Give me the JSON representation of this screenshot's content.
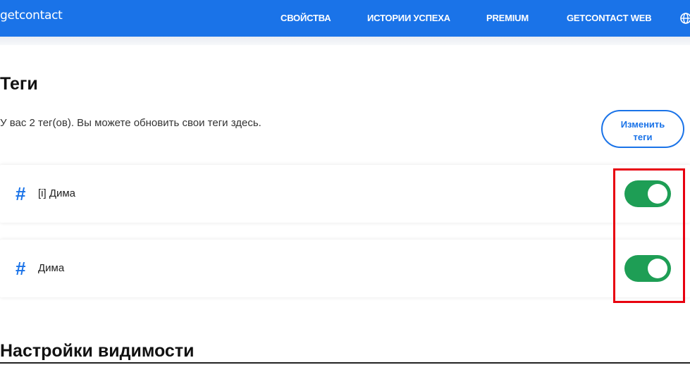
{
  "header": {
    "logo": "getcontact",
    "nav": [
      {
        "label": "СВОЙСТВА"
      },
      {
        "label": "ИСТОРИИ УСПЕХА"
      },
      {
        "label": "PREMIUM"
      },
      {
        "label": "GETCONTACT WEB"
      }
    ],
    "globe_icon": "globe-icon"
  },
  "tags": {
    "title": "Теги",
    "description": "У вас 2 тег(ов). Вы можете обновить свои теги здесь.",
    "edit_button": "Изменить теги",
    "items": [
      {
        "hash": "#",
        "label": "[i] Дима",
        "enabled": true
      },
      {
        "hash": "#",
        "label": "Дима",
        "enabled": true
      }
    ]
  },
  "visibility": {
    "title": "Настройки видимости"
  },
  "colors": {
    "brand_blue": "#1a73e8",
    "toggle_on": "#1e9e55",
    "highlight_red": "#e8000f"
  }
}
